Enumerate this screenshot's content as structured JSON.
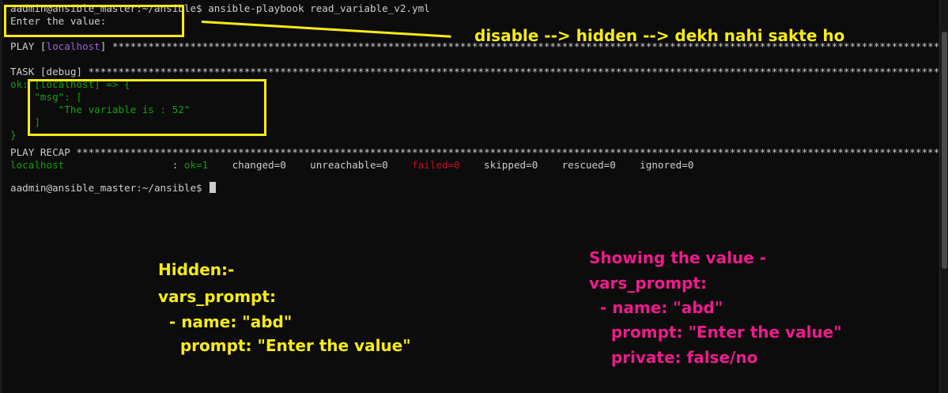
{
  "terminal": {
    "line1_prompt": "aadmin@ansible_master:~/ansible$",
    "line1_cmd": " ansible-playbook read_variable_v2.yml",
    "line2": "Enter the value:",
    "play_prefix": "PLAY [",
    "play_host": "localhost",
    "play_suffix": "] *********************************************************************************************************************************************************************************************",
    "task_line": "TASK [debug] ******************************************************************************************************************************************************************************************",
    "ok_line": "ok: [localhost] => {",
    "msg_key": "    \"msg\": [",
    "msg_value": "        \"The variable is : 52\"",
    "msg_close": "    ]",
    "brace_close": "}",
    "recap_line": "PLAY RECAP ********************************************************************************************************************************************************************************************",
    "recap_host": "localhost                  ",
    "recap_sep": ": ",
    "recap_ok": "ok=1",
    "recap_changed": "    changed=0    unreachable=0    ",
    "recap_failed": "failed=0",
    "recap_rest": "    skipped=0    rescued=0    ignored=0",
    "final_prompt": "aadmin@ansible_master:~/ansible$ "
  },
  "annotations": {
    "top_note": "disable --> hidden --> dekh nahi sakte ho",
    "hidden_title": "Hidden:-",
    "hidden_l1": "vars_prompt:",
    "hidden_l2": "  - name: \"abd\"",
    "hidden_l3": "    prompt: \"Enter the value\"",
    "show_title": "Showing the value -",
    "show_l1": "vars_prompt:",
    "show_l2": "  - name: \"abd\"",
    "show_l3": "    prompt: \"Enter the value\"",
    "show_l4": "    private: false/no"
  },
  "colors": {
    "background": "#0c0c0c",
    "text": "#cccccc",
    "ok_green": "#13a10e",
    "host_purple": "#a05fe0",
    "failed_red": "#c50f1f",
    "annotation_yellow": "#f7ec13",
    "annotation_pink": "#ee1b8d"
  }
}
